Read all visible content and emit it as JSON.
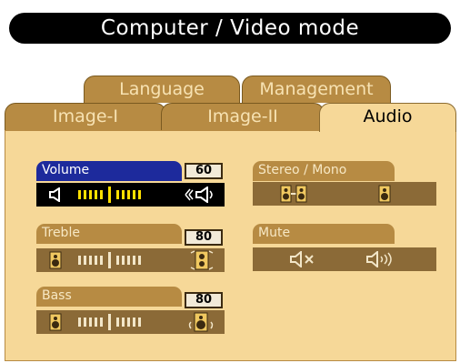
{
  "header": {
    "title": "Computer / Video mode"
  },
  "tabs": {
    "back_row": [
      {
        "label": "Language"
      },
      {
        "label": "Management"
      }
    ],
    "front_row": [
      {
        "label": "Image-I"
      },
      {
        "label": "Image-II"
      },
      {
        "label": "Audio"
      }
    ],
    "active": "Audio"
  },
  "controls": {
    "volume": {
      "label": "Volume",
      "value": "60",
      "selected": true
    },
    "treble": {
      "label": "Treble",
      "value": "80"
    },
    "bass": {
      "label": "Bass",
      "value": "80"
    },
    "stereo_mono": {
      "label": "Stereo / Mono",
      "options": [
        "stereo-speakers-icon",
        "mono-speaker-icon"
      ]
    },
    "mute": {
      "label": "Mute",
      "options": [
        "speaker-muted-icon",
        "speaker-sound-icon"
      ]
    }
  },
  "colors": {
    "panel": "#f6d898",
    "tab": "#b78b43",
    "bar": "#8b6a37",
    "selected_label": "#1d2a9c",
    "selected_bar": "#000000",
    "selected_tick": "#ffe000"
  }
}
